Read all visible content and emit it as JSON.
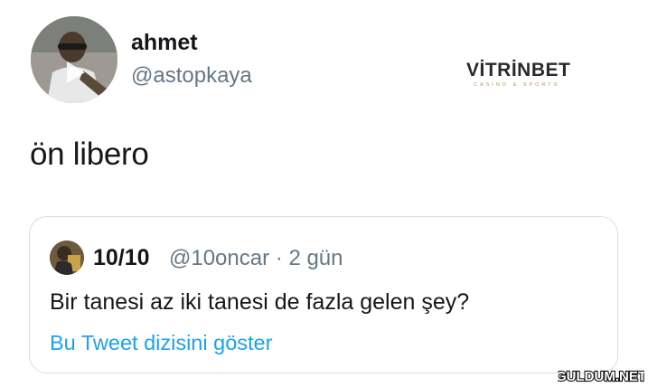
{
  "tweet": {
    "author": {
      "display_name": "ahmet",
      "handle": "@astopkaya"
    },
    "text": "ön libero"
  },
  "quoted_tweet": {
    "author": {
      "display_name": "10/10",
      "handle": "@10oncar"
    },
    "time": "2 gün",
    "separator": "·",
    "text": "Bir tanesi az iki tanesi de fazla gelen şey?",
    "show_thread_label": "Bu Tweet dizisini göster"
  },
  "watermarks": {
    "brand_logo_text": "VİTRİNBET",
    "brand_logo_tagline": "CASINO & SPORTS",
    "site_logo_text": "GULDUM.NET"
  },
  "colors": {
    "link": "#1da1f2",
    "secondary_text": "#657786",
    "primary_text": "#14171a",
    "card_border": "#d9dee3",
    "brand_gold": "#b8955a"
  }
}
